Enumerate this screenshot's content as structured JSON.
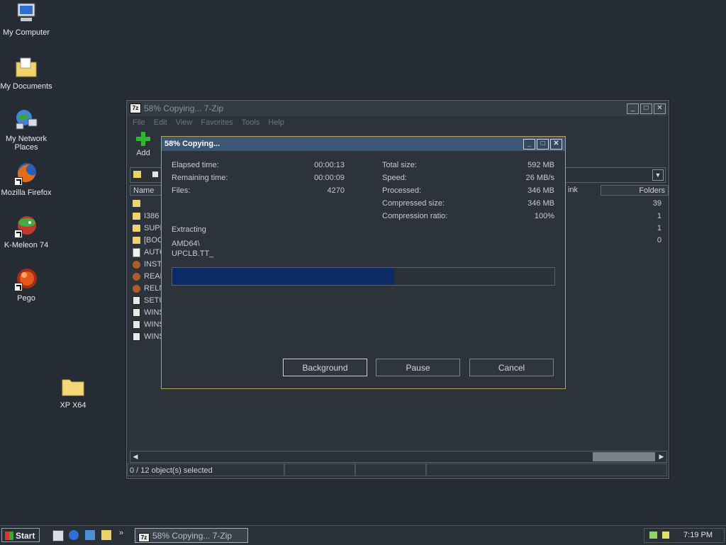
{
  "desktop": {
    "icons": [
      {
        "label": "My Computer",
        "icon": "computer-icon"
      },
      {
        "label": "My Documents",
        "icon": "documents-folder-icon"
      },
      {
        "label": "My Network\nPlaces",
        "label_line1": "My Network",
        "label_line2": "Places",
        "icon": "network-icon"
      },
      {
        "label": "Mozilla Firefox",
        "icon": "firefox-icon"
      },
      {
        "label": "K-Meleon 74",
        "icon": "kmeleon-icon"
      },
      {
        "label": "Pego",
        "icon": "pego-icon"
      },
      {
        "label": "XP X64",
        "icon": "folder-icon"
      }
    ]
  },
  "main_window": {
    "title": "58% Copying... 7-Zip",
    "app_icon_text": "7z",
    "menu": [
      "File",
      "Edit",
      "View",
      "Favorites",
      "Tools",
      "Help"
    ],
    "toolbar": {
      "add_label": "Add"
    },
    "columns": {
      "name": "Name",
      "link": "ink",
      "folders": "Folders"
    },
    "files": [
      {
        "name": "",
        "type": "folder",
        "folders": "39"
      },
      {
        "name": "I386",
        "type": "folder",
        "folders": "1"
      },
      {
        "name": "SUPF",
        "type": "folder",
        "folders": "1"
      },
      {
        "name": "[BOC",
        "type": "folder",
        "folders": "0"
      },
      {
        "name": "AUTC",
        "type": "doc",
        "folders": ""
      },
      {
        "name": "INST",
        "type": "ie",
        "folders": ""
      },
      {
        "name": "READ",
        "type": "ie",
        "folders": ""
      },
      {
        "name": "RELN",
        "type": "ie",
        "folders": ""
      },
      {
        "name": "SETU",
        "type": "exe",
        "folders": ""
      },
      {
        "name": "WINS",
        "type": "exe",
        "folders": ""
      },
      {
        "name": "WINS",
        "type": "exe",
        "folders": ""
      },
      {
        "name": "WINS",
        "type": "exe",
        "folders": ""
      }
    ],
    "status": {
      "selection": "0 / 12 object(s) selected"
    }
  },
  "dialog": {
    "title": "58% Copying...",
    "elapsed_label": "Elapsed time:",
    "elapsed_value": "00:00:13",
    "remaining_label": "Remaining time:",
    "remaining_value": "00:00:09",
    "files_label": "Files:",
    "files_value": "4270",
    "total_size_label": "Total size:",
    "total_size_value": "592 MB",
    "speed_label": "Speed:",
    "speed_value": "26 MB/s",
    "processed_label": "Processed:",
    "processed_value": "346 MB",
    "compressed_size_label": "Compressed size:",
    "compressed_size_value": "346 MB",
    "compression_ratio_label": "Compression ratio:",
    "compression_ratio_value": "100%",
    "operation": "Extracting",
    "current_path": "AMD64\\",
    "current_file": "UPCLB.TT_",
    "progress": 0.58,
    "buttons": {
      "background": "Background",
      "pause": "Pause",
      "cancel": "Cancel"
    }
  },
  "taskbar": {
    "start_label": "Start",
    "task_label": "58% Copying... 7-Zip",
    "task_icon_text": "7z",
    "clock": "7:19 PM"
  }
}
